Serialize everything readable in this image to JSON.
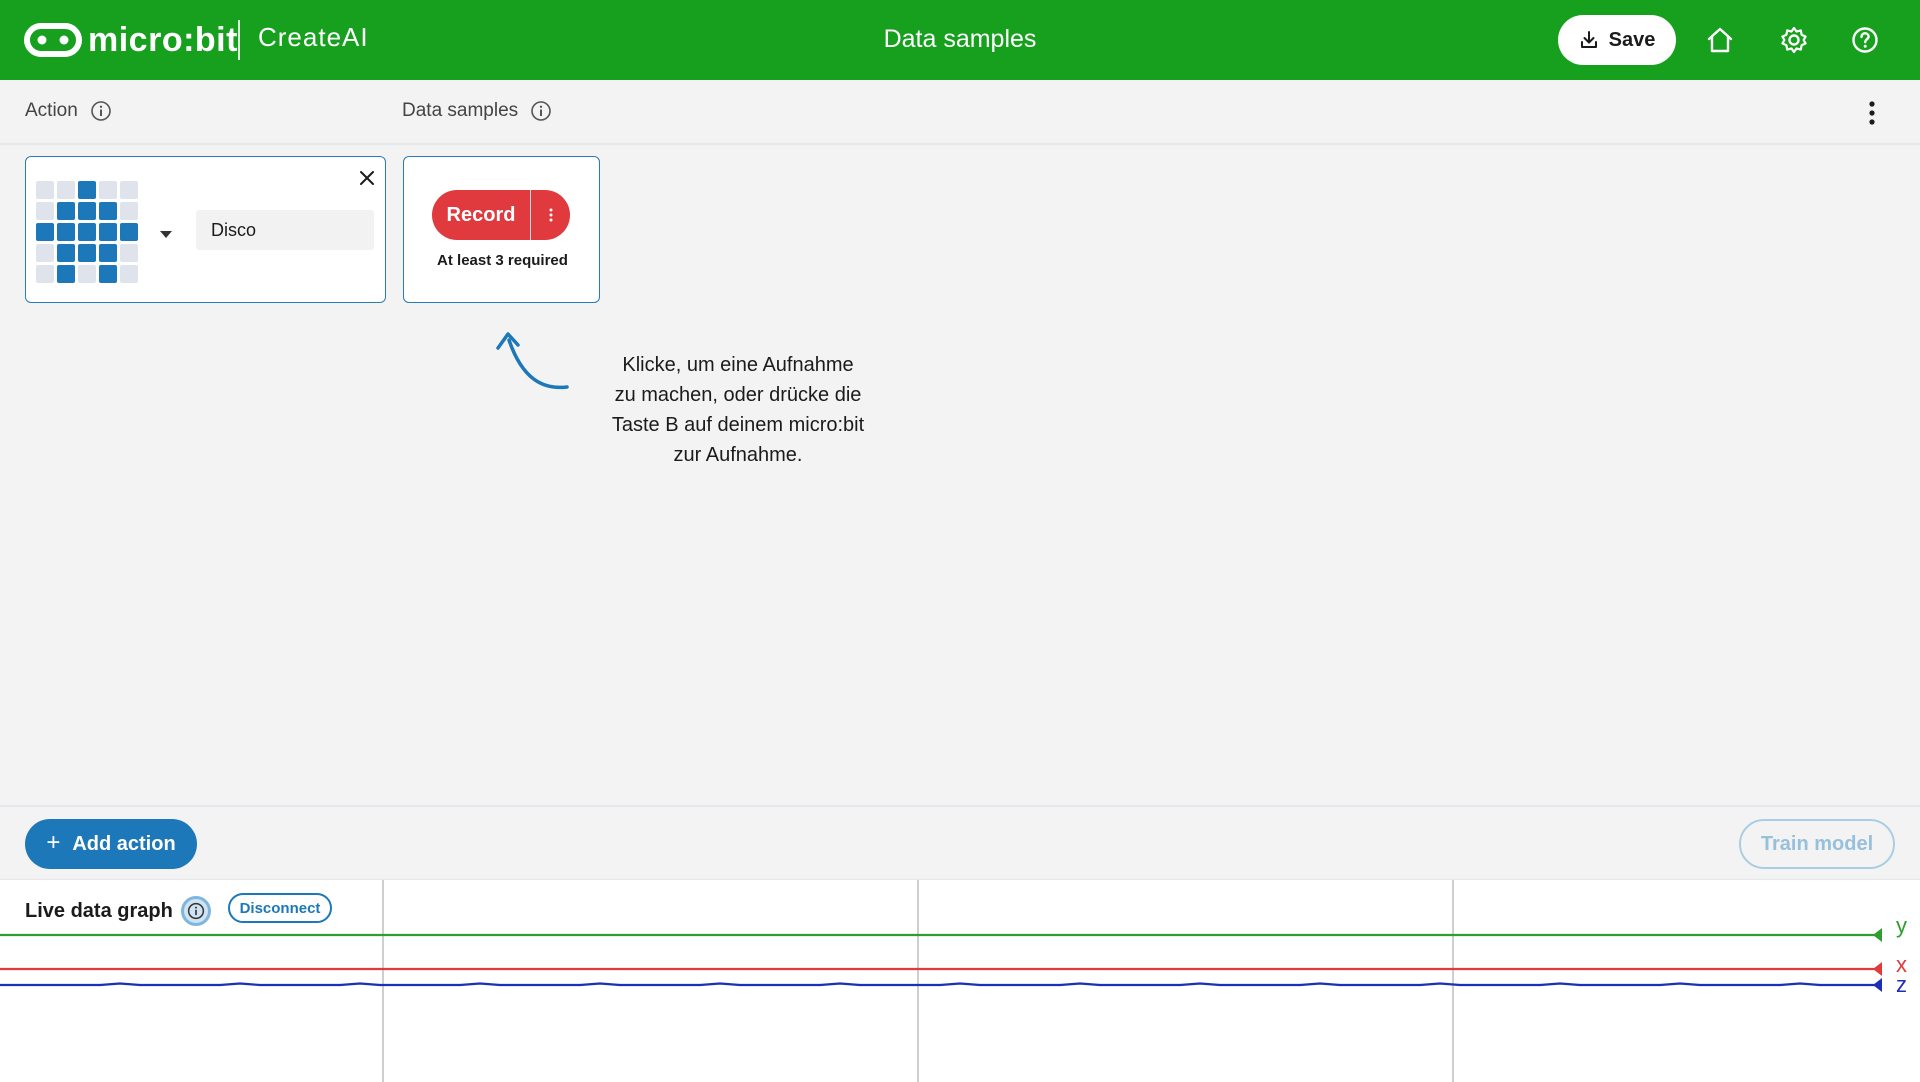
{
  "header": {
    "logo_text": "micro:bit",
    "product_name": "CreateAI",
    "page_title": "Data samples",
    "save_label": "Save",
    "brand_color": "#16a01e"
  },
  "columns": {
    "action_label": "Action",
    "data_samples_label": "Data samples"
  },
  "action_card": {
    "name": "Disco",
    "led_pattern": [
      [
        0,
        0,
        1,
        0,
        0
      ],
      [
        0,
        1,
        1,
        1,
        0
      ],
      [
        1,
        1,
        1,
        1,
        1
      ],
      [
        0,
        1,
        1,
        1,
        0
      ],
      [
        0,
        1,
        0,
        1,
        0
      ]
    ]
  },
  "record_card": {
    "record_label": "Record",
    "requirement_note": "At least 3 required",
    "record_color": "#e0393e"
  },
  "hint": {
    "lines": [
      "Klicke, um eine Aufnahme",
      "zu machen, oder drücke die",
      "Taste B auf deinem micro:bit",
      "zur Aufnahme."
    ]
  },
  "bottom_bar": {
    "add_action_label": "Add action",
    "train_model_label": "Train model"
  },
  "live_graph": {
    "title": "Live data graph",
    "disconnect_label": "Disconnect",
    "series": [
      {
        "name": "y",
        "color": "#2e9e2e"
      },
      {
        "name": "x",
        "color": "#e23a3a"
      },
      {
        "name": "z",
        "color": "#1c2fb8"
      }
    ]
  }
}
